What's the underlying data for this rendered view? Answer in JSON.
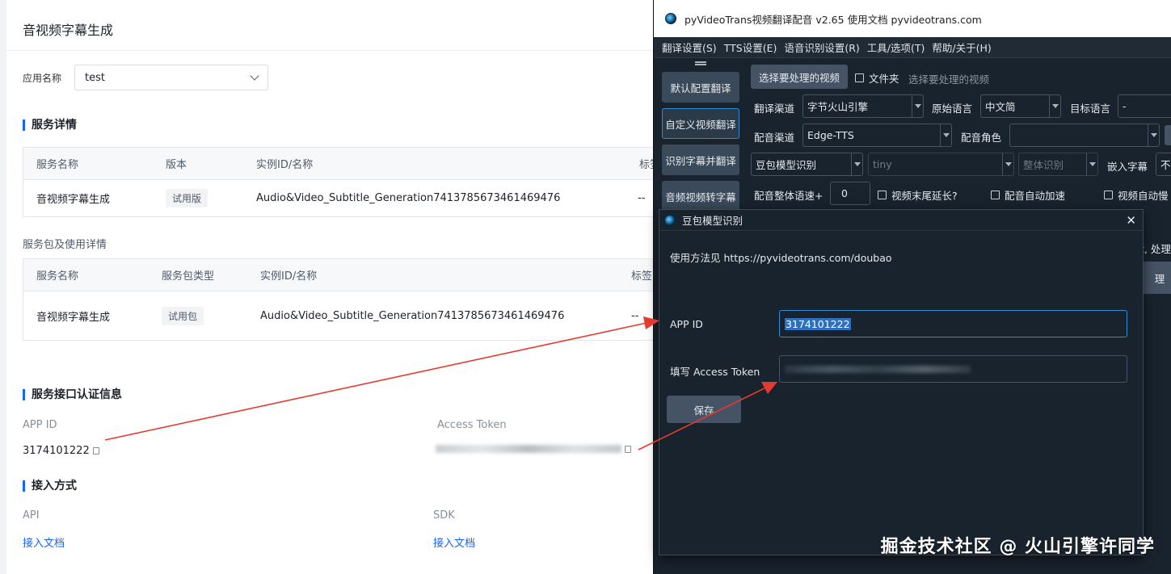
{
  "web": {
    "page_title": "音视频字幕生成",
    "app_name_label": "应用名称",
    "app_name_value": "test",
    "service_detail_title": "服务详情",
    "service_table": {
      "headers": [
        "服务名称",
        "版本",
        "实例ID/名称",
        "标签"
      ],
      "row": [
        "音视频字幕生成",
        "试用版",
        "Audio&Video_Subtitle_Generation7413785673461469476",
        "--"
      ]
    },
    "package_title": "服务包及使用详情",
    "package_table": {
      "headers": [
        "服务名称",
        "服务包类型",
        "实例ID/名称",
        "标签"
      ],
      "row": [
        "音视频字幕生成",
        "试用包",
        "Audio&Video_Subtitle_Generation7413785673461469476",
        "--"
      ]
    },
    "auth_title": "服务接口认证信息",
    "app_id_label": "APP ID",
    "app_id_value": "3174101222",
    "access_token_label": "Access Token",
    "access_title": "接入方式",
    "api_label": "API",
    "sdk_label": "SDK",
    "api_doc_link": "接入文档",
    "sdk_doc_link": "接入文档"
  },
  "app": {
    "window_title": "pyVideoTrans视频翻译配音 v2.65  使用文档  pyvideotrans.com",
    "menu": [
      "翻译设置(S)",
      "TTS设置(E)",
      "语音识别设置(R)",
      "工具/选项(T)",
      "帮助/关于(H)"
    ],
    "sidebar": [
      "默认配置翻译",
      "自定义视频翻译",
      "识别字幕并翻译",
      "音频视频转字幕"
    ],
    "select_video_button": "选择要处理的视频",
    "folder_checkbox": "文件夹",
    "select_video_hint": "选择要处理的视频",
    "translate_channel_label": "翻译渠道",
    "translate_channel_value": "字节火山引擎",
    "source_lang_label": "原始语言",
    "source_lang_value": "中文简",
    "target_lang_label": "目标语言",
    "target_lang_value": "-",
    "dub_channel_label": "配音渠道",
    "dub_channel_value": "Edge-TTS",
    "dub_role_label": "配音角色",
    "dub_role_value": "",
    "asr_value": "豆包模型识别",
    "model_value": "tiny",
    "whole_recog_value": "整体识别",
    "embed_sub_label": "嵌入字幕",
    "embed_sub_value": "不",
    "speed_label": "配音整体语速+",
    "speed_value": "0",
    "video_extend_checkbox": "视频末尾延长?",
    "auto_speed_checkbox": "配音自动加速",
    "video_slow_checkbox": "视频自动慢",
    "right_edge_text_1": "t, 处理",
    "right_edge_text_2": "理"
  },
  "dialog": {
    "title": "豆包模型识别",
    "usage_text": "使用方法见 https://pyvideotrans.com/doubao",
    "app_id_label": "APP ID",
    "app_id_value": "3174101222",
    "token_label": "填写 Access Token",
    "save_button": "保存"
  },
  "watermark": "掘金技术社区 @ 火山引擎许同学",
  "colors": {
    "accent_blue": "#1664ff",
    "dark_bg": "#19232d",
    "focus_blue": "#2f8bd6",
    "arrow_red": "#e53a2f"
  }
}
